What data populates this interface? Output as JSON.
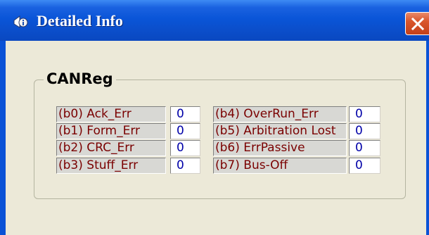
{
  "window": {
    "title": "Detailed Info",
    "title_icon": "info-app-icon",
    "close_icon": "close-icon",
    "accent": "#0a55d8",
    "close_color": "#d9562c"
  },
  "group": {
    "title": "CANReg"
  },
  "fields_left": [
    {
      "label": "(b0) Ack_Err",
      "value": "0"
    },
    {
      "label": "(b1) Form_Err",
      "value": "0"
    },
    {
      "label": "(b2) CRC_Err",
      "value": "0"
    },
    {
      "label": "(b3) Stuff_Err",
      "value": "0"
    }
  ],
  "fields_right": [
    {
      "label": "(b4) OverRun_Err",
      "value": "0"
    },
    {
      "label": "(b5) Arbitration Lost",
      "value": "0"
    },
    {
      "label": "(b6) ErrPassive",
      "value": "0"
    },
    {
      "label": "(b7) Bus-Off",
      "value": "0"
    }
  ]
}
